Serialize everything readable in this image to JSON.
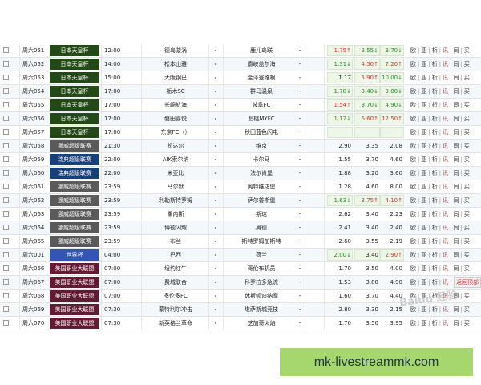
{
  "colors": {
    "japan_cup": "#234a16",
    "norway": "#5a5a5a",
    "sweden": "#173f78",
    "world_cup": "#3355b3",
    "mls": "#631b33",
    "banner_bg": "#a5d76e",
    "odds_up": "#d23a3a",
    "odds_down": "#2c8b2c"
  },
  "rows": [
    {
      "num": "周六051",
      "league": "日本天皇杯",
      "color_key": "japan_cup",
      "time": "12:00",
      "home": "德岛漩涡",
      "dash": "-",
      "away": "鹿儿岛联",
      "dash2": "-",
      "o1": "1.75",
      "a1": "up",
      "o2": "3.55",
      "a2": "down",
      "o3": "3.70",
      "a3": "down",
      "boxed": true
    },
    {
      "num": "周六052",
      "league": "日本天皇杯",
      "color_key": "japan_cup",
      "time": "14:00",
      "home": "松本山雅",
      "dash": "-",
      "away": "麝峽盖尔海",
      "dash2": "-",
      "o1": "1.31",
      "a1": "down",
      "o2": "4.50",
      "a2": "up",
      "o3": "7.20",
      "a3": "up",
      "boxed": true
    },
    {
      "num": "周六053",
      "league": "日本天皇杯",
      "color_key": "japan_cup",
      "time": "15:00",
      "home": "大阪钢巴",
      "dash": "-",
      "away": "金泽塞维根",
      "dash2": "-",
      "o1": "1.17",
      "a1": "",
      "o2": "5.90",
      "a2": "up",
      "o3": "10.00",
      "a3": "down",
      "boxed": true
    },
    {
      "num": "周六054",
      "league": "日本天皇杯",
      "color_key": "japan_cup",
      "time": "17:00",
      "home": "栃木SC",
      "dash": "-",
      "away": "群马温泉",
      "dash2": "-",
      "o1": "1.78",
      "a1": "down",
      "o2": "3.40",
      "a2": "down",
      "o3": "3.80",
      "a3": "down",
      "boxed": true
    },
    {
      "num": "周六055",
      "league": "日本天皇杯",
      "color_key": "japan_cup",
      "time": "17:00",
      "home": "长崎航海",
      "dash": "-",
      "away": "岐阜FC",
      "dash2": "-",
      "o1": "1.54",
      "a1": "up",
      "o2": "3.70",
      "a2": "down",
      "o3": "4.90",
      "a3": "down",
      "boxed": true
    },
    {
      "num": "周六056",
      "league": "日本天皇杯",
      "color_key": "japan_cup",
      "time": "17:00",
      "home": "磐田喜悦",
      "dash": "-",
      "away": "藍桃MYFC",
      "dash2": "-",
      "o1": "1.12",
      "a1": "down",
      "o2": "6.60",
      "a2": "up",
      "o3": "12.50",
      "a3": "up",
      "boxed": true
    },
    {
      "num": "周六057",
      "league": "日本天皇杯",
      "color_key": "japan_cup",
      "time": "17:00",
      "home": "东京FC（）",
      "dash": "-",
      "away": "秋田蓝色闪电",
      "dash2": "-",
      "o1": "",
      "a1": "",
      "o2": "",
      "a2": "",
      "o3": "",
      "a3": "",
      "boxed": true
    },
    {
      "num": "周六058",
      "league": "挪威超级联赛",
      "color_key": "norway",
      "time": "21:30",
      "home": "松达尔",
      "dash": "-",
      "away": "维京",
      "dash2": "-",
      "o1": "2.90",
      "a1": "",
      "o2": "3.35",
      "a2": "",
      "o3": "2.08",
      "a3": "",
      "boxed": false
    },
    {
      "num": "周六059",
      "league": "瑞典超级联赛",
      "color_key": "sweden",
      "time": "22:00",
      "home": "AIK索尔纳",
      "dash": "-",
      "away": "卡尔马",
      "dash2": "-",
      "o1": "1.55",
      "a1": "",
      "o2": "3.70",
      "a2": "",
      "o3": "4.60",
      "a3": "",
      "boxed": false
    },
    {
      "num": "周六060",
      "league": "瑞典超级联赛",
      "color_key": "sweden",
      "time": "22:00",
      "home": "米亚比",
      "dash": "-",
      "away": "法尔肯堡",
      "dash2": "-",
      "o1": "1.88",
      "a1": "",
      "o2": "3.20",
      "a2": "",
      "o3": "3.60",
      "a3": "",
      "boxed": false
    },
    {
      "num": "周六061",
      "league": "挪威超级联赛",
      "color_key": "norway",
      "time": "23:59",
      "home": "马尔默",
      "dash": "-",
      "away": "奥特维达堡",
      "dash2": "-",
      "o1": "1.28",
      "a1": "",
      "o2": "4.60",
      "a2": "",
      "o3": "8.00",
      "a3": "",
      "boxed": false
    },
    {
      "num": "周六062",
      "league": "挪威超级联赛",
      "color_key": "norway",
      "time": "23:59",
      "home": "利勒斯特罗姆",
      "dash": "-",
      "away": "萨尔普斯堡",
      "dash2": "-",
      "o1": "1.63",
      "a1": "down",
      "o2": "3.75",
      "a2": "up",
      "o3": "4.10",
      "a3": "up",
      "boxed": true
    },
    {
      "num": "周六063",
      "league": "挪威超级联赛",
      "color_key": "norway",
      "time": "23:59",
      "home": "桑内斯",
      "dash": "-",
      "away": "斯达",
      "dash2": "-",
      "o1": "2.62",
      "a1": "",
      "o2": "3.40",
      "a2": "",
      "o3": "2.23",
      "a3": "",
      "boxed": false
    },
    {
      "num": "周六064",
      "league": "挪威超级联赛",
      "color_key": "norway",
      "time": "23:59",
      "home": "博德闪耀",
      "dash": "-",
      "away": "奥德",
      "dash2": "-",
      "o1": "2.41",
      "a1": "",
      "o2": "3.40",
      "a2": "",
      "o3": "2.40",
      "a3": "",
      "boxed": false
    },
    {
      "num": "周六065",
      "league": "挪威超级联赛",
      "color_key": "norway",
      "time": "23:59",
      "home": "布兰",
      "dash": "-",
      "away": "斯特罗姆加斯特",
      "dash2": "-",
      "o1": "2.60",
      "a1": "",
      "o2": "3.55",
      "a2": "",
      "o3": "2.19",
      "a3": "",
      "boxed": false
    },
    {
      "num": "周六001",
      "league": "世界杯",
      "color_key": "world_cup",
      "time": "04:00",
      "home": "巴西",
      "dash": "-",
      "away": "荷兰",
      "dash2": "-",
      "o1": "2.00",
      "a1": "down",
      "o2": "3.40",
      "a2": "",
      "o3": "2.90",
      "a3": "up",
      "boxed": true
    },
    {
      "num": "周六066",
      "league": "美国职业大联盟",
      "color_key": "mls",
      "time": "07:00",
      "home": "纽约红牛",
      "dash": "-",
      "away": "哥伦布机员",
      "dash2": "-",
      "o1": "1.70",
      "a1": "",
      "o2": "3.50",
      "a2": "",
      "o3": "4.00",
      "a3": "",
      "boxed": false
    },
    {
      "num": "周六067",
      "league": "美国职业大联盟",
      "color_key": "mls",
      "time": "07:00",
      "home": "费城联合",
      "dash": "-",
      "away": "科罗拉多急流",
      "dash2": "-",
      "o1": "1.53",
      "a1": "",
      "o2": "3.80",
      "a2": "",
      "o3": "4.90",
      "a3": "",
      "boxed": false
    },
    {
      "num": "周六068",
      "league": "美国职业大联盟",
      "color_key": "mls",
      "time": "07:00",
      "home": "多伦多FC",
      "dash": "-",
      "away": "休斯顿迪纳摩",
      "dash2": "-",
      "o1": "1.60",
      "a1": "",
      "o2": "3.70",
      "a2": "",
      "o3": "4.40",
      "a3": "",
      "boxed": false
    },
    {
      "num": "周六069",
      "league": "美国职业大联盟",
      "color_key": "mls",
      "time": "07:30",
      "home": "蒙特利尔冲击",
      "dash": "-",
      "away": "堪萨斯城竞技",
      "dash2": "-",
      "o1": "2.80",
      "a1": "",
      "o2": "3.30",
      "a2": "",
      "o3": "2.15",
      "a3": "",
      "boxed": false
    },
    {
      "num": "周六070",
      "league": "美国职业大联盟",
      "color_key": "mls",
      "time": "07:30",
      "home": "新英格兰革命",
      "dash": "-",
      "away": "芝加哥火焰",
      "dash2": "-",
      "o1": "1.70",
      "a1": "",
      "o2": "3.50",
      "a2": "",
      "o3": "3.95",
      "a3": "",
      "boxed": false
    }
  ],
  "row_links": [
    "欧",
    "亚",
    "析",
    "讯",
    "同",
    "买"
  ],
  "back_top_label": "返回顶部",
  "banner": {
    "text": "mk-livestreammk.com"
  },
  "watermark": "Baidu 经验"
}
